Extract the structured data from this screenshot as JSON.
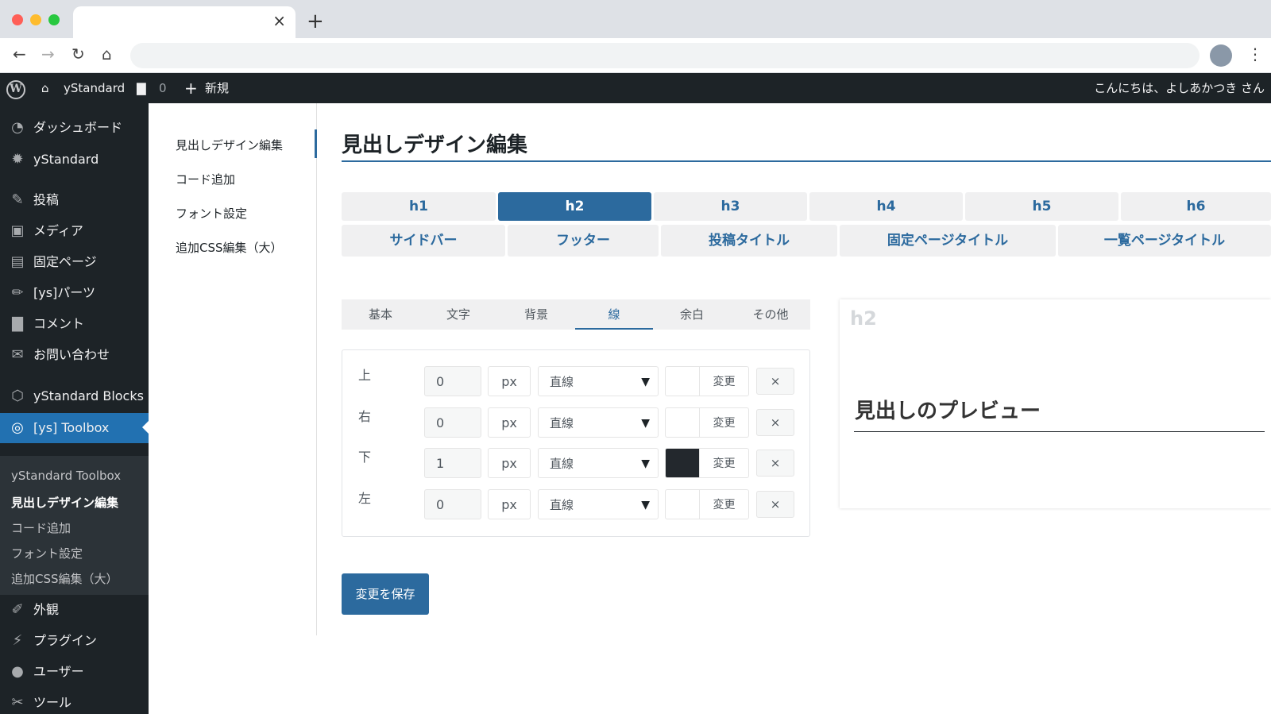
{
  "browser": {
    "traffic_colors": [
      "#ff5f57",
      "#febc2e",
      "#28c840"
    ],
    "tab_close": "×",
    "new_tab": "+"
  },
  "adminbar": {
    "site_name": "yStandard",
    "comments_count": "0",
    "new_label": "新規",
    "greeting": "こんにちは、よしあかつき さん"
  },
  "sidebar": {
    "items": [
      {
        "label": "ダッシュボード",
        "icon": "dashboard-icon"
      },
      {
        "label": "yStandard",
        "icon": "gear-icon"
      },
      {
        "label": "投稿",
        "icon": "pin-icon"
      },
      {
        "label": "メディア",
        "icon": "media-icon"
      },
      {
        "label": "固定ページ",
        "icon": "page-icon"
      },
      {
        "label": "[ys]パーツ",
        "icon": "pencil-icon"
      },
      {
        "label": "コメント",
        "icon": "comment-icon"
      },
      {
        "label": "お問い合わせ",
        "icon": "mail-icon"
      },
      {
        "label": "yStandard Blocks",
        "icon": "cube-icon"
      },
      {
        "label": "[ys] Toolbox",
        "icon": "toolbox-icon"
      },
      {
        "label": "外観",
        "icon": "brush-icon"
      },
      {
        "label": "プラグイン",
        "icon": "plug-icon"
      },
      {
        "label": "ユーザー",
        "icon": "user-icon"
      },
      {
        "label": "ツール",
        "icon": "wrench-icon"
      }
    ],
    "submenu": [
      "yStandard Toolbox",
      "見出しデザイン編集",
      "コード追加",
      "フォント設定",
      "追加CSS編集（大）"
    ]
  },
  "subnav": {
    "items": [
      "見出しデザイン編集",
      "コード追加",
      "フォント設定",
      "追加CSS編集（大）"
    ]
  },
  "main": {
    "title": "見出しデザイン編集",
    "heading_tabs": [
      "h1",
      "h2",
      "h3",
      "h4",
      "h5",
      "h6"
    ],
    "section_tabs": [
      "サイドバー",
      "フッター",
      "投稿タイトル",
      "固定ページタイトル",
      "一覧ページタイトル"
    ],
    "property_tabs": [
      "基本",
      "文字",
      "背景",
      "線",
      "余白",
      "その他"
    ],
    "border_rows": [
      {
        "side": "上",
        "width": "0",
        "unit": "px",
        "style": "直線",
        "color": "#ffffff",
        "change": "変更",
        "clear": "×"
      },
      {
        "side": "右",
        "width": "0",
        "unit": "px",
        "style": "直線",
        "color": "#ffffff",
        "change": "変更",
        "clear": "×"
      },
      {
        "side": "下",
        "width": "1",
        "unit": "px",
        "style": "直線",
        "color": "#23282d",
        "change": "変更",
        "clear": "×"
      },
      {
        "side": "左",
        "width": "0",
        "unit": "px",
        "style": "直線",
        "color": "#ffffff",
        "change": "変更",
        "clear": "×"
      }
    ],
    "save_label": "変更を保存"
  },
  "preview": {
    "tag": "h2",
    "heading": "見出しのプレビュー"
  },
  "colors": {
    "accent": "#2c6a9e",
    "wp_active": "#2271b1",
    "wp_dark": "#1d2327"
  }
}
